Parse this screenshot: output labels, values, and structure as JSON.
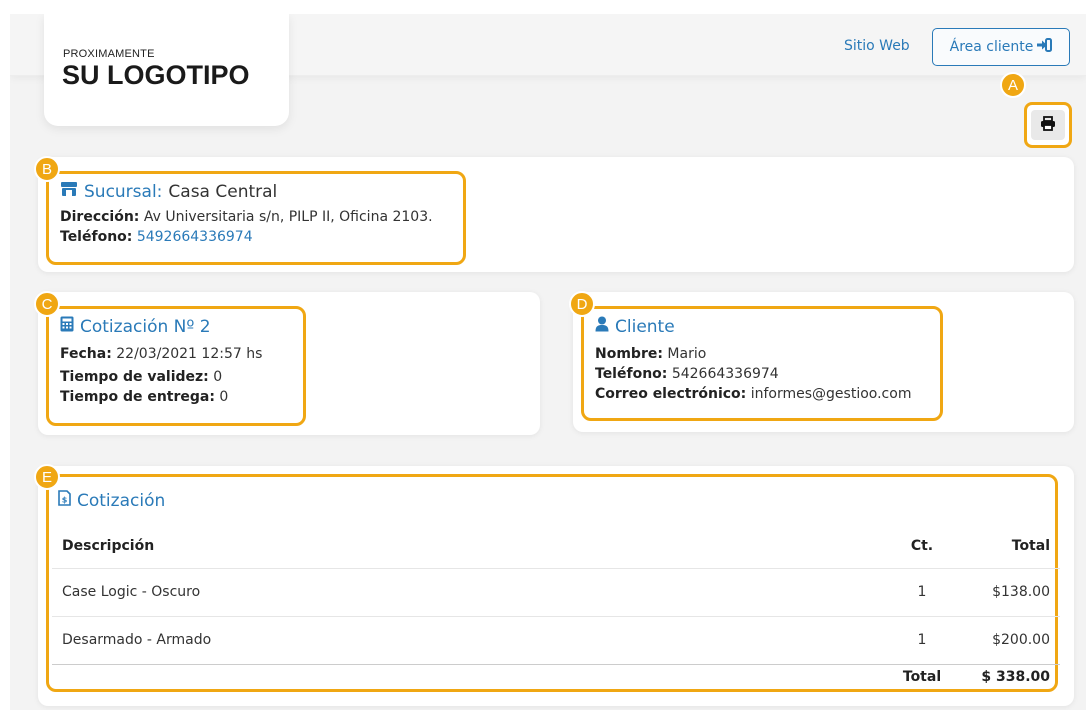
{
  "header": {
    "logo_small": "PROXIMAMENTE",
    "logo_big": "SU LOGOTIPO",
    "site_link": "Sitio Web",
    "client_area_label": "Área cliente"
  },
  "markers": {
    "a": "A",
    "b": "B",
    "c": "C",
    "d": "D",
    "e": "E"
  },
  "branch": {
    "label": "Sucursal:",
    "name": "Casa Central",
    "address_label": "Dirección:",
    "address": "Av Universitaria s/n, PILP II, Oficina 2103.",
    "phone_label": "Teléfono:",
    "phone": "5492664336974"
  },
  "quote": {
    "title": "Cotización Nº 2",
    "date_label": "Fecha:",
    "date": "22/03/2021 12:57 hs",
    "validity_label": "Tiempo de validez:",
    "validity": "0",
    "delivery_label": "Tiempo de entrega:",
    "delivery": "0"
  },
  "client": {
    "title": "Cliente",
    "name_label": "Nombre:",
    "name": "Mario",
    "phone_label": "Teléfono:",
    "phone": "542664336974",
    "email_label": "Correo electrónico:",
    "email": "informes@gestioo.com"
  },
  "items_section": {
    "title": "Cotización",
    "columns": [
      "Descripción",
      "Ct.",
      "Total"
    ],
    "rows": [
      {
        "description": "Case Logic - Oscuro",
        "qty": "1",
        "total": "$138.00"
      },
      {
        "description": "Desarmado - Armado",
        "qty": "1",
        "total": "$200.00"
      }
    ],
    "footer_label": "Total",
    "footer_total": "$ 338.00"
  },
  "colors": {
    "accent": "#2a7ab8",
    "highlight": "#f0a713"
  }
}
